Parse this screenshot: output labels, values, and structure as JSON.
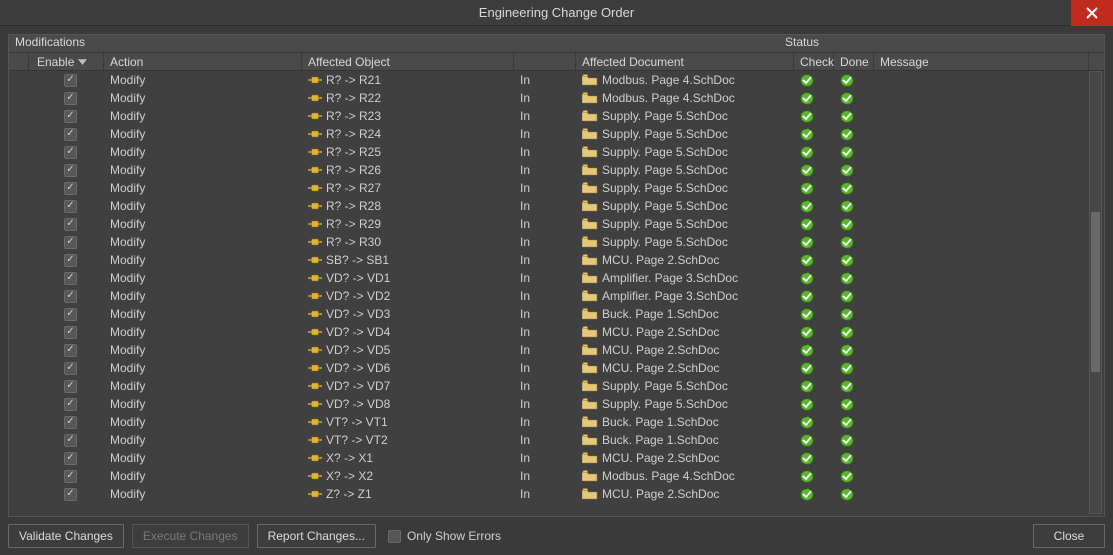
{
  "window": {
    "title": "Engineering Change Order"
  },
  "groupHeaders": {
    "left": "Modifications",
    "right": "Status"
  },
  "columns": {
    "enable": "Enable",
    "action": "Action",
    "object": "Affected Object",
    "in": "",
    "document": "Affected Document",
    "check": "Check",
    "done": "Done",
    "message": "Message"
  },
  "footer": {
    "validate": "Validate Changes",
    "execute": "Execute Changes",
    "report": "Report Changes...",
    "onlyErrors": "Only Show Errors",
    "close": "Close"
  },
  "rows": [
    {
      "enabled": true,
      "action": "Modify",
      "object": "R? -> R21",
      "in": "In",
      "doc": "Modbus. Page 4.SchDoc",
      "check": true,
      "done": true
    },
    {
      "enabled": true,
      "action": "Modify",
      "object": "R? -> R22",
      "in": "In",
      "doc": "Modbus. Page 4.SchDoc",
      "check": true,
      "done": true
    },
    {
      "enabled": true,
      "action": "Modify",
      "object": "R? -> R23",
      "in": "In",
      "doc": "Supply. Page 5.SchDoc",
      "check": true,
      "done": true
    },
    {
      "enabled": true,
      "action": "Modify",
      "object": "R? -> R24",
      "in": "In",
      "doc": "Supply. Page 5.SchDoc",
      "check": true,
      "done": true
    },
    {
      "enabled": true,
      "action": "Modify",
      "object": "R? -> R25",
      "in": "In",
      "doc": "Supply. Page 5.SchDoc",
      "check": true,
      "done": true
    },
    {
      "enabled": true,
      "action": "Modify",
      "object": "R? -> R26",
      "in": "In",
      "doc": "Supply. Page 5.SchDoc",
      "check": true,
      "done": true
    },
    {
      "enabled": true,
      "action": "Modify",
      "object": "R? -> R27",
      "in": "In",
      "doc": "Supply. Page 5.SchDoc",
      "check": true,
      "done": true
    },
    {
      "enabled": true,
      "action": "Modify",
      "object": "R? -> R28",
      "in": "In",
      "doc": "Supply. Page 5.SchDoc",
      "check": true,
      "done": true
    },
    {
      "enabled": true,
      "action": "Modify",
      "object": "R? -> R29",
      "in": "In",
      "doc": "Supply. Page 5.SchDoc",
      "check": true,
      "done": true
    },
    {
      "enabled": true,
      "action": "Modify",
      "object": "R? -> R30",
      "in": "In",
      "doc": "Supply. Page 5.SchDoc",
      "check": true,
      "done": true
    },
    {
      "enabled": true,
      "action": "Modify",
      "object": "SB? -> SB1",
      "in": "In",
      "doc": "MCU. Page 2.SchDoc",
      "check": true,
      "done": true
    },
    {
      "enabled": true,
      "action": "Modify",
      "object": "VD? -> VD1",
      "in": "In",
      "doc": "Amplifier. Page 3.SchDoc",
      "check": true,
      "done": true
    },
    {
      "enabled": true,
      "action": "Modify",
      "object": "VD? -> VD2",
      "in": "In",
      "doc": "Amplifier. Page 3.SchDoc",
      "check": true,
      "done": true
    },
    {
      "enabled": true,
      "action": "Modify",
      "object": "VD? -> VD3",
      "in": "In",
      "doc": "Buck. Page 1.SchDoc",
      "check": true,
      "done": true
    },
    {
      "enabled": true,
      "action": "Modify",
      "object": "VD? -> VD4",
      "in": "In",
      "doc": "MCU. Page 2.SchDoc",
      "check": true,
      "done": true
    },
    {
      "enabled": true,
      "action": "Modify",
      "object": "VD? -> VD5",
      "in": "In",
      "doc": "MCU. Page 2.SchDoc",
      "check": true,
      "done": true
    },
    {
      "enabled": true,
      "action": "Modify",
      "object": "VD? -> VD6",
      "in": "In",
      "doc": "MCU. Page 2.SchDoc",
      "check": true,
      "done": true
    },
    {
      "enabled": true,
      "action": "Modify",
      "object": "VD? -> VD7",
      "in": "In",
      "doc": "Supply. Page 5.SchDoc",
      "check": true,
      "done": true
    },
    {
      "enabled": true,
      "action": "Modify",
      "object": "VD? -> VD8",
      "in": "In",
      "doc": "Supply. Page 5.SchDoc",
      "check": true,
      "done": true
    },
    {
      "enabled": true,
      "action": "Modify",
      "object": "VT? -> VT1",
      "in": "In",
      "doc": "Buck. Page 1.SchDoc",
      "check": true,
      "done": true
    },
    {
      "enabled": true,
      "action": "Modify",
      "object": "VT? -> VT2",
      "in": "In",
      "doc": "Buck. Page 1.SchDoc",
      "check": true,
      "done": true
    },
    {
      "enabled": true,
      "action": "Modify",
      "object": "X? -> X1",
      "in": "In",
      "doc": "MCU. Page 2.SchDoc",
      "check": true,
      "done": true
    },
    {
      "enabled": true,
      "action": "Modify",
      "object": "X? -> X2",
      "in": "In",
      "doc": "Modbus. Page 4.SchDoc",
      "check": true,
      "done": true
    },
    {
      "enabled": true,
      "action": "Modify",
      "object": "Z? -> Z1",
      "in": "In",
      "doc": "MCU. Page 2.SchDoc",
      "check": true,
      "done": true
    }
  ]
}
